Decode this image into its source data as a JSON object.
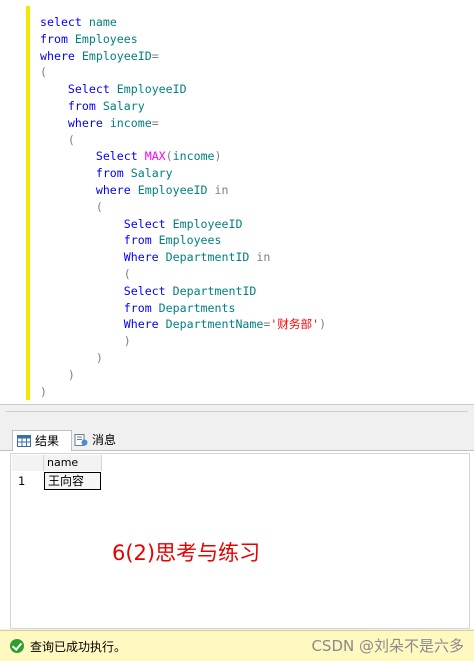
{
  "editor": {
    "lines": [
      [
        {
          "t": "select ",
          "c": "kw"
        },
        {
          "t": "name",
          "c": "id"
        }
      ],
      [
        {
          "t": "from ",
          "c": "kw"
        },
        {
          "t": "Employees",
          "c": "id"
        }
      ],
      [
        {
          "t": "where ",
          "c": "kw"
        },
        {
          "t": "EmployeeID",
          "c": "id"
        },
        {
          "t": "=",
          "c": "op"
        }
      ],
      [
        {
          "t": "(",
          "c": "p"
        }
      ],
      [
        {
          "t": "    "
        },
        {
          "t": "Select ",
          "c": "kw"
        },
        {
          "t": "EmployeeID",
          "c": "id"
        }
      ],
      [
        {
          "t": "    "
        },
        {
          "t": "from ",
          "c": "kw"
        },
        {
          "t": "Salary",
          "c": "id"
        }
      ],
      [
        {
          "t": "    "
        },
        {
          "t": "where ",
          "c": "kw"
        },
        {
          "t": "income",
          "c": "id"
        },
        {
          "t": "=",
          "c": "op"
        }
      ],
      [
        {
          "t": "    "
        },
        {
          "t": "(",
          "c": "p"
        }
      ],
      [
        {
          "t": "        "
        },
        {
          "t": "Select ",
          "c": "kw"
        },
        {
          "t": "MAX",
          "c": "fn"
        },
        {
          "t": "(",
          "c": "p"
        },
        {
          "t": "income",
          "c": "id"
        },
        {
          "t": ")",
          "c": "p"
        }
      ],
      [
        {
          "t": "        "
        },
        {
          "t": "from ",
          "c": "kw"
        },
        {
          "t": "Salary",
          "c": "id"
        }
      ],
      [
        {
          "t": "        "
        },
        {
          "t": "where ",
          "c": "kw"
        },
        {
          "t": "EmployeeID ",
          "c": "id"
        },
        {
          "t": "in",
          "c": "p"
        }
      ],
      [
        {
          "t": "        "
        },
        {
          "t": "(",
          "c": "p"
        }
      ],
      [
        {
          "t": "            "
        },
        {
          "t": "Select ",
          "c": "kw"
        },
        {
          "t": "EmployeeID",
          "c": "id"
        }
      ],
      [
        {
          "t": "            "
        },
        {
          "t": "from ",
          "c": "kw"
        },
        {
          "t": "Employees",
          "c": "id"
        }
      ],
      [
        {
          "t": "            "
        },
        {
          "t": "Where ",
          "c": "kw"
        },
        {
          "t": "DepartmentID ",
          "c": "id"
        },
        {
          "t": "in",
          "c": "p"
        }
      ],
      [
        {
          "t": "            "
        },
        {
          "t": "(",
          "c": "p"
        }
      ],
      [
        {
          "t": "            "
        },
        {
          "t": "Select ",
          "c": "kw"
        },
        {
          "t": "DepartmentID",
          "c": "id"
        }
      ],
      [
        {
          "t": "            "
        },
        {
          "t": "from ",
          "c": "kw"
        },
        {
          "t": "Departments",
          "c": "id"
        }
      ],
      [
        {
          "t": "            "
        },
        {
          "t": "Where ",
          "c": "kw"
        },
        {
          "t": "DepartmentName",
          "c": "id"
        },
        {
          "t": "=",
          "c": "op"
        },
        {
          "t": "'财务部'",
          "c": "str"
        },
        {
          "t": ")",
          "c": "p"
        }
      ],
      [
        {
          "t": "            "
        },
        {
          "t": ")",
          "c": "p"
        }
      ],
      [
        {
          "t": "        "
        },
        {
          "t": ")",
          "c": "p"
        }
      ],
      [
        {
          "t": "    "
        },
        {
          "t": ")",
          "c": "p"
        }
      ],
      [
        {
          "t": ")",
          "c": "p"
        }
      ]
    ]
  },
  "tabs": {
    "results_label": "结果",
    "messages_label": "消息"
  },
  "grid": {
    "column_header": "name",
    "row_number": "1",
    "cell_value": "王向容"
  },
  "annotation": "6(2)思考与练习",
  "status": {
    "text": "查询已成功执行。",
    "watermark": "CSDN @刘朵不是六多"
  },
  "colors": {
    "keyword": "#0000ff",
    "identifier": "#008080",
    "function": "#ff00ff",
    "string": "#ff0000",
    "status_bg": "#fff8c0",
    "annotation": "#e60000"
  }
}
